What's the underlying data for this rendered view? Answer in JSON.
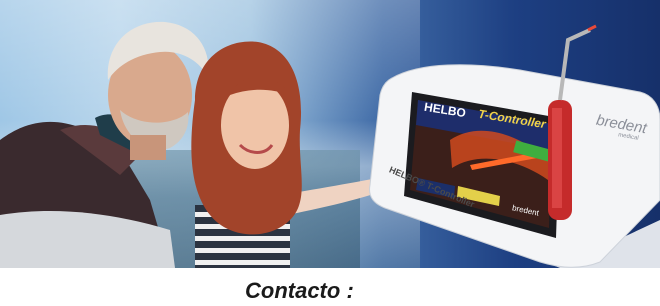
{
  "banner": {
    "device": {
      "brand_logo": "bredent",
      "brand_subtext": "medical",
      "base_label": "HELBO® T-Controller",
      "screen": {
        "logo": "HELBO",
        "title": "T-Controller",
        "footer_brand": "bredent"
      }
    }
  },
  "caption": {
    "text": "Contacto :"
  }
}
